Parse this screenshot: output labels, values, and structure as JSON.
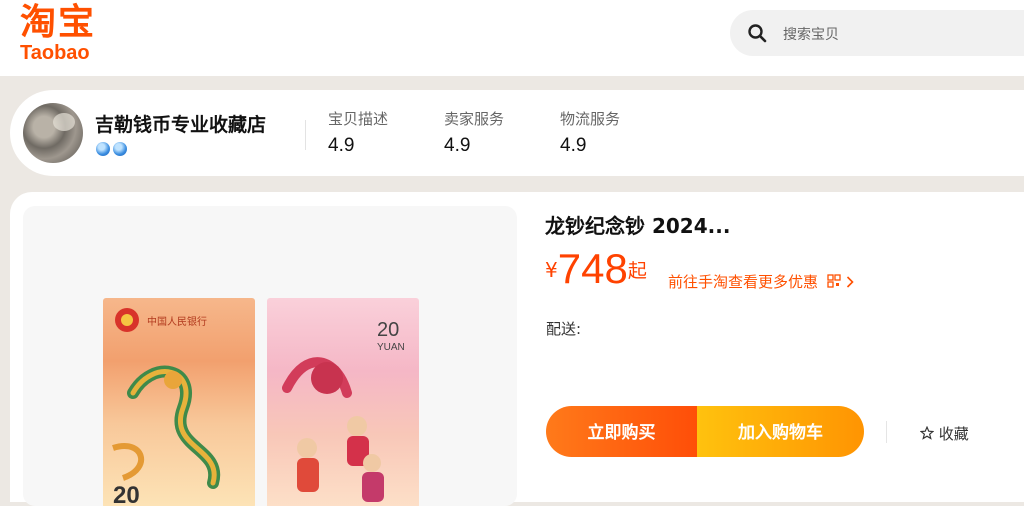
{
  "header": {
    "logo_cn": "淘宝",
    "logo_en": "Taobao",
    "search_placeholder": "搜索宝贝",
    "brand_color": "#ff5000"
  },
  "shop": {
    "name": "吉勒钱币专业收藏店",
    "ratings": [
      {
        "label": "宝贝描述",
        "value": "4.9"
      },
      {
        "label": "卖家服务",
        "value": "4.9"
      },
      {
        "label": "物流服务",
        "value": "4.9"
      }
    ]
  },
  "product": {
    "title": "龙钞纪念钞 2024...",
    "currency": "¥",
    "price": "748",
    "price_suffix": "起",
    "promo_link": "前往手淘查看更多优惠",
    "delivery_label": "配送:",
    "buy_label": "立即购买",
    "cart_label": "加入购物车",
    "favorite_label": "收藏",
    "note_front": {
      "bank": "中国人民银行",
      "value": "20"
    },
    "note_back": {
      "value": "20",
      "unit": "YUAN"
    }
  },
  "colors": {
    "accent": "#ff4200",
    "buy": "#ff5a0d",
    "cart": "#ffab06"
  }
}
